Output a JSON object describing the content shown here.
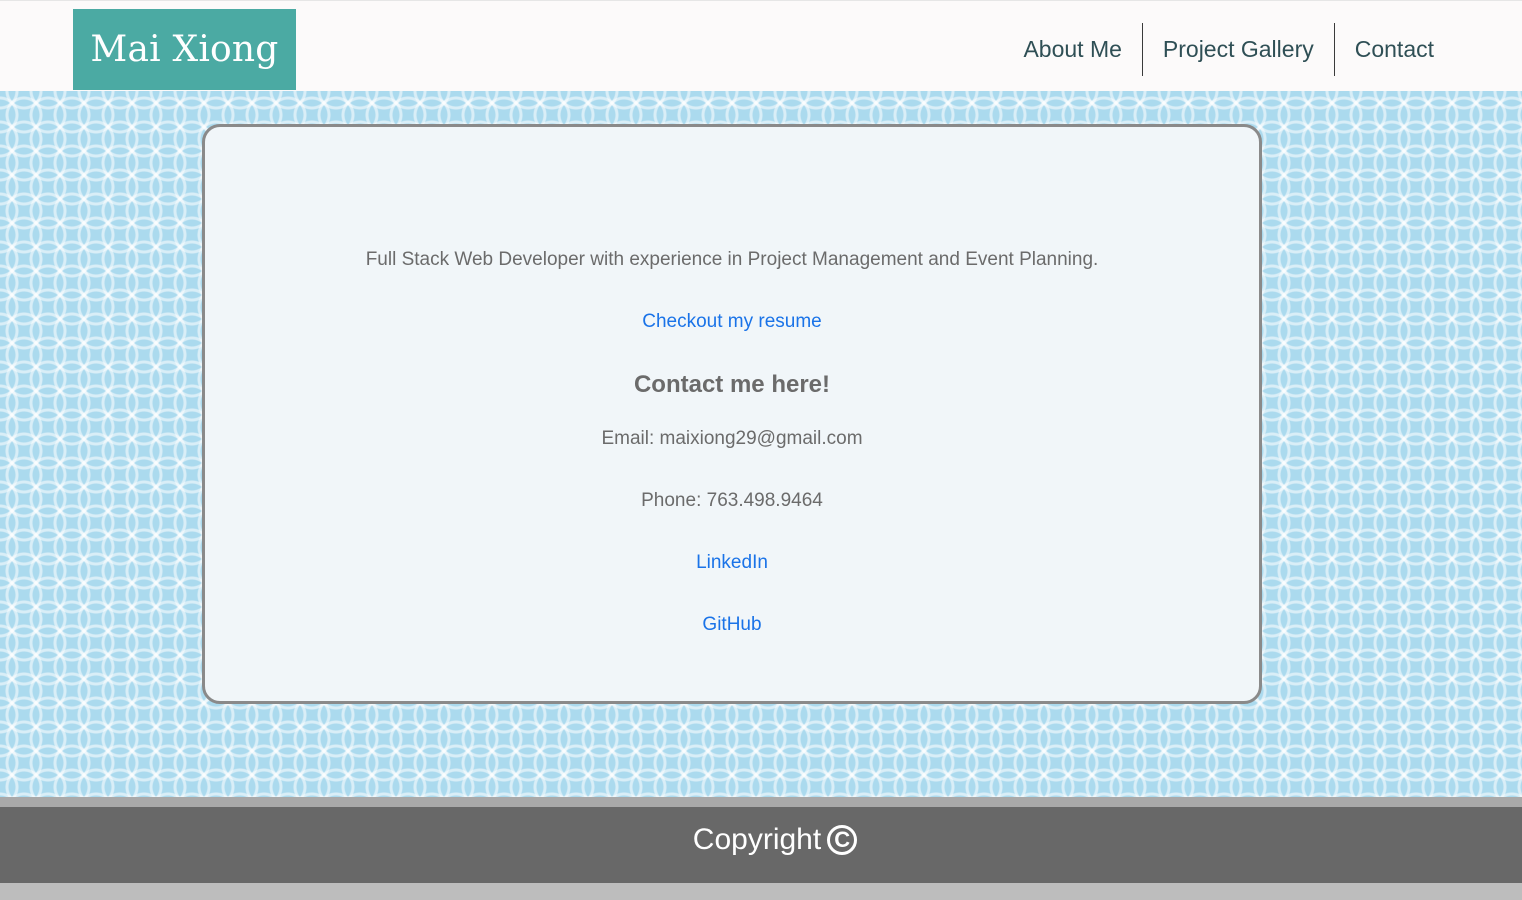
{
  "header": {
    "brand": "Mai Xiong",
    "nav": [
      "About Me",
      "Project Gallery",
      "Contact"
    ]
  },
  "card": {
    "tagline": "Full Stack Web Developer with experience in Project Management and Event Planning.",
    "resume_link": "Checkout my resume",
    "contact_heading": "Contact me here!",
    "email": "Email: maixiong29@gmail.com",
    "phone": "Phone: 763.498.9464",
    "linkedin": "LinkedIn",
    "github": "GitHub"
  },
  "footer": {
    "copyright": "Copyright",
    "copyright_icon": "copyright-icon"
  },
  "colors": {
    "brand_bg": "#4baaa3",
    "link": "#1a73e8",
    "page_pattern": "#abdaee",
    "footer_bg": "#686868"
  }
}
